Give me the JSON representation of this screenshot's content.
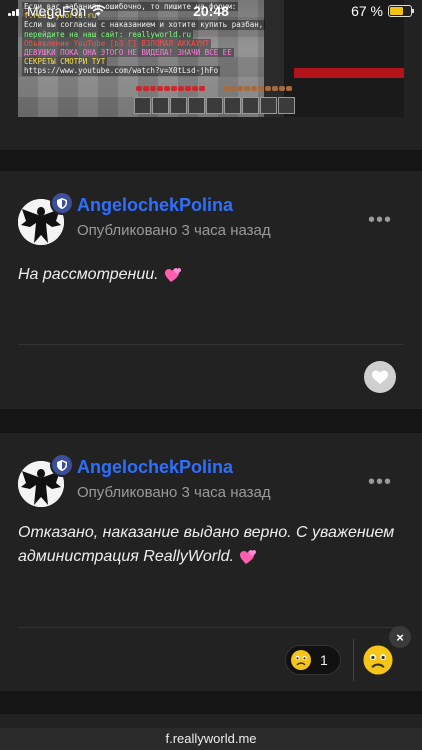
{
  "status_bar": {
    "carrier": "MegaFon",
    "time": "20:48",
    "battery": "67 %",
    "battery_level": 0.67
  },
  "embedded_screenshot": {
    "chat_lines": [
      "Если вас забанили ошибочно, то пишите на форум:",
      "f.reallyworld.ru",
      "Если вы согласны с наказанием и хотите купить разбан,",
      "перейдите на наш сайт: reallyworld.ru",
      "Объявление YouTube [b3 Г]   ВЗЛОМАЛ АККАУНТ",
      "ДЕВУШКИ ПОКА ОНА ЭТОГО НЕ ВИДЕЛА! ЗНАЧИ ВСЕ ЕЕ",
      "СЕКРЕТЫ СМОТРИ ТУТ",
      "https://www.youtube.com/watch?v=X0tLsd-jhFo"
    ]
  },
  "posts": [
    {
      "author": "AngelochekPolina",
      "published": "Опубликовано 3 часа назад",
      "more": "•••",
      "content": "На рассмотрении."
    },
    {
      "author": "AngelochekPolina",
      "published": "Опубликовано 3 часа назад",
      "more": "•••",
      "content": "Отказано, наказание выдано верно. С уважением администрация ReallyWorld.",
      "reaction_count": "1",
      "close": "×"
    }
  ],
  "url_bar": {
    "url": "f.reallyworld.me"
  },
  "colors": {
    "author": "#2f6fff",
    "background": "#151515",
    "card": "#222222"
  }
}
